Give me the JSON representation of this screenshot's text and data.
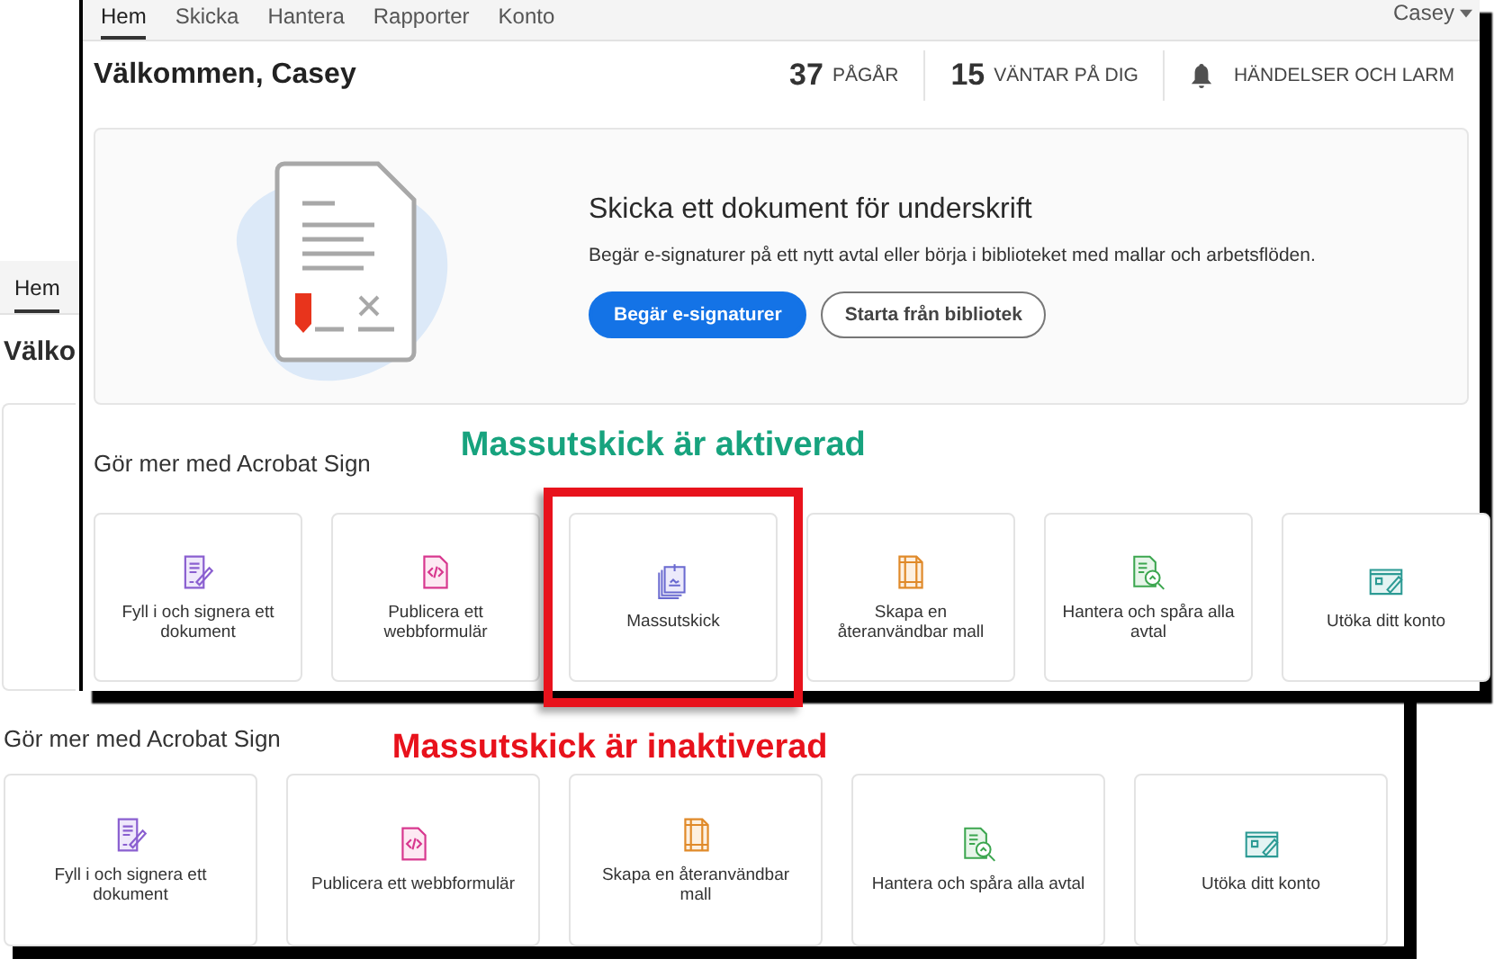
{
  "back_window": {
    "tabs": [
      {
        "label": "Hem",
        "selected": true
      }
    ],
    "greeting": "Välko",
    "section_title": "Gör mer med Acrobat Sign",
    "annotation": {
      "text": "Massutskick är inaktiverad",
      "color": "#e8121c"
    },
    "cards": [
      {
        "kind": "fill-sign",
        "label": "Fyll i och signera ett dokument"
      },
      {
        "kind": "web-form",
        "label": "Publicera ett webbformulär"
      },
      {
        "kind": "template",
        "label": "Skapa en återanvändbar mall"
      },
      {
        "kind": "track",
        "label": "Hantera och spåra alla avtal"
      },
      {
        "kind": "account",
        "label": "Utöka ditt konto"
      }
    ]
  },
  "front_window": {
    "tabs": [
      {
        "label": "Hem",
        "selected": true
      },
      {
        "label": "Skicka",
        "selected": false
      },
      {
        "label": "Hantera",
        "selected": false
      },
      {
        "label": "Rapporter",
        "selected": false
      },
      {
        "label": "Konto",
        "selected": false
      }
    ],
    "user_menu": "Casey",
    "greeting": "Välkommen, Casey",
    "stats": [
      {
        "value": "37",
        "label": "PÅGÅR"
      },
      {
        "value": "15",
        "label": "VÄNTAR PÅ DIG"
      }
    ],
    "notifications": "HÄNDELSER OCH LARM",
    "hero": {
      "title": "Skicka ett dokument för underskrift",
      "description": "Begär e-signaturer på ett nytt avtal eller börja i biblioteket med mallar och arbetsflöden.",
      "buttons": [
        {
          "kind": "primary",
          "label": "Begär e-signaturer"
        },
        {
          "kind": "secondary",
          "label": "Starta från bibliotek"
        }
      ]
    },
    "section_title": "Gör mer med Acrobat Sign",
    "annotation": {
      "text": "Massutskick är aktiverad",
      "color": "#17a37e"
    },
    "cards": [
      {
        "kind": "fill-sign",
        "label": "Fyll i och signera ett dokument",
        "highlighted": false
      },
      {
        "kind": "web-form",
        "label": "Publicera ett webbformulär",
        "highlighted": false
      },
      {
        "kind": "bulk-send",
        "label": "Massutskick",
        "highlighted": true
      },
      {
        "kind": "template",
        "label": "Skapa en återanvändbar mall",
        "highlighted": false
      },
      {
        "kind": "track",
        "label": "Hantera och spåra alla avtal",
        "highlighted": false
      },
      {
        "kind": "account",
        "label": "Utöka ditt konto",
        "highlighted": false
      }
    ]
  }
}
